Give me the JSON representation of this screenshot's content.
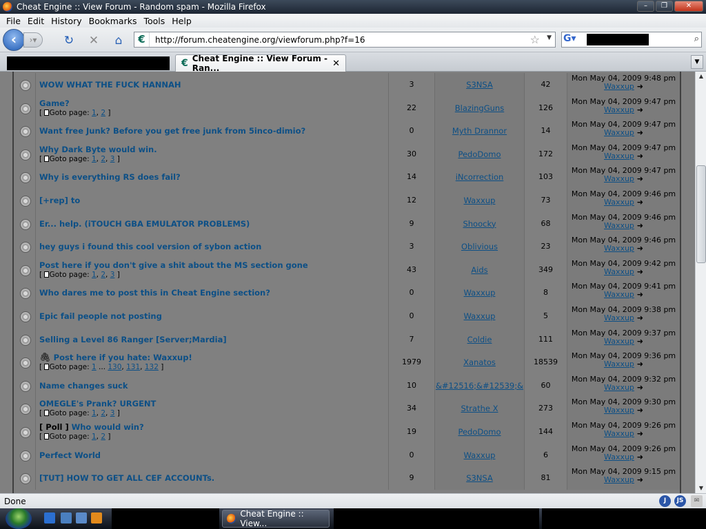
{
  "window": {
    "title": "Cheat Engine :: View Forum - Random spam - Mozilla Firefox"
  },
  "menu": [
    "File",
    "Edit",
    "History",
    "Bookmarks",
    "Tools",
    "Help"
  ],
  "url": "http://forum.cheatengine.org/viewforum.php?f=16",
  "tab": {
    "label": "Cheat Engine :: View Forum - Ran..."
  },
  "status": "Done",
  "taskbar": {
    "window_label": "Cheat Engine :: View..."
  },
  "labels": {
    "goto": "Goto page:",
    "poll": "[ Poll ]"
  },
  "topics": [
    {
      "title": "WOW WHAT THE FUCK HANNAH",
      "pages": [],
      "replies": "3",
      "author": "S3NSA",
      "views": "42",
      "date": "Mon May 04, 2009 9:48 pm",
      "last": "Waxxup"
    },
    {
      "title": "Game?",
      "pages": [
        "1",
        "2"
      ],
      "replies": "22",
      "author": "BlazingGuns",
      "views": "126",
      "date": "Mon May 04, 2009 9:47 pm",
      "last": "Waxxup"
    },
    {
      "title": "Want free Junk? Before you get free junk from 5inco-dimio?",
      "pages": [],
      "replies": "0",
      "author": "Myth Drannor",
      "views": "14",
      "date": "Mon May 04, 2009 9:47 pm",
      "last": "Waxxup"
    },
    {
      "title": "Why Dark Byte would win.",
      "pages": [
        "1",
        "2",
        "3"
      ],
      "replies": "30",
      "author": "PedoDomo",
      "views": "172",
      "date": "Mon May 04, 2009 9:47 pm",
      "last": "Waxxup"
    },
    {
      "title": "Why is everything RS does fail?",
      "pages": [],
      "replies": "14",
      "author": "iNcorrection",
      "views": "103",
      "date": "Mon May 04, 2009 9:47 pm",
      "last": "Waxxup"
    },
    {
      "title": "[+rep] to",
      "pages": [],
      "replies": "12",
      "author": "Waxxup",
      "views": "73",
      "date": "Mon May 04, 2009 9:46 pm",
      "last": "Waxxup"
    },
    {
      "title": "Er... help. (iTOUCH GBA EMULATOR PROBLEMS)",
      "pages": [],
      "replies": "9",
      "author": "Shoocky",
      "views": "68",
      "date": "Mon May 04, 2009 9:46 pm",
      "last": "Waxxup"
    },
    {
      "title": "hey guys i found this cool version of sybon action",
      "pages": [],
      "replies": "3",
      "author": "Oblivious",
      "views": "23",
      "date": "Mon May 04, 2009 9:46 pm",
      "last": "Waxxup"
    },
    {
      "title": "Post here if you don't give a shit about the MS section gone",
      "pages": [
        "1",
        "2",
        "3"
      ],
      "replies": "43",
      "author": "Aids",
      "views": "349",
      "date": "Mon May 04, 2009 9:42 pm",
      "last": "Waxxup"
    },
    {
      "title": "Who dares me to post this in Cheat Engine section?",
      "pages": [],
      "replies": "0",
      "author": "Waxxup",
      "views": "8",
      "date": "Mon May 04, 2009 9:41 pm",
      "last": "Waxxup"
    },
    {
      "title": "Epic fail people not posting",
      "pages": [],
      "replies": "0",
      "author": "Waxxup",
      "views": "5",
      "date": "Mon May 04, 2009 9:38 pm",
      "last": "Waxxup"
    },
    {
      "title": "Selling a Level 86 Ranger [Server;Mardia]",
      "pages": [],
      "replies": "7",
      "author": "Coldie",
      "views": "111",
      "date": "Mon May 04, 2009 9:37 pm",
      "last": "Waxxup"
    },
    {
      "title": "Post here if you hate: Waxxup!",
      "pages": [
        "1",
        "...",
        "130",
        "131",
        "132"
      ],
      "replies": "1979",
      "author": "Xanatos",
      "views": "18539",
      "date": "Mon May 04, 2009 9:36 pm",
      "last": "Waxxup",
      "attach": true
    },
    {
      "title": "Name changes suck",
      "pages": [],
      "replies": "10",
      "author": "&#12516;&#12539;&",
      "views": "60",
      "date": "Mon May 04, 2009 9:32 pm",
      "last": "Waxxup"
    },
    {
      "title": "OMEGLE's Prank? URGENT",
      "pages": [
        "1",
        "2",
        "3"
      ],
      "replies": "34",
      "author": "Strathe X",
      "views": "273",
      "date": "Mon May 04, 2009 9:30 pm",
      "last": "Waxxup"
    },
    {
      "title": "Who would win?",
      "pages": [
        "1",
        "2"
      ],
      "replies": "19",
      "author": "PedoDomo",
      "views": "144",
      "date": "Mon May 04, 2009 9:26 pm",
      "last": "Waxxup",
      "poll": true
    },
    {
      "title": "Perfect World",
      "pages": [],
      "replies": "0",
      "author": "Waxxup",
      "views": "6",
      "date": "Mon May 04, 2009 9:26 pm",
      "last": "Waxxup"
    },
    {
      "title": "[TUT] HOW TO GET ALL CEF ACCOUNTs.",
      "pages": [],
      "replies": "9",
      "author": "S3NSA",
      "views": "81",
      "date": "Mon May 04, 2009 9:15 pm",
      "last": "Waxxup"
    }
  ]
}
